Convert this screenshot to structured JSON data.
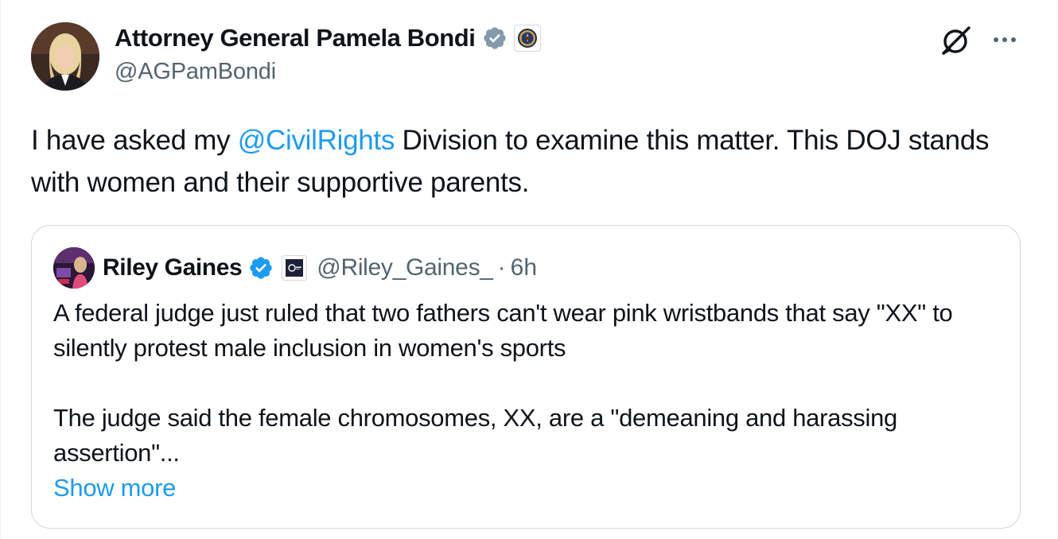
{
  "colors": {
    "accent": "#1d9bf0",
    "text": "#0f1419",
    "secondary": "#536471",
    "verified_gray": "#829aab",
    "verified_blue": "#1d9bf0"
  },
  "author": {
    "display_name": "Attorney General Pamela Bondi",
    "handle": "@AGPamBondi",
    "badge_icon": "verified-gray-badge-icon",
    "affiliation_icon": "doj-seal-icon"
  },
  "actions": {
    "grok_icon": "grok-icon",
    "more_icon": "more-horizontal-icon"
  },
  "tweet": {
    "text_before": "I have asked my ",
    "mention": "@CivilRights",
    "text_after": " Division to examine this matter. This DOJ stands with women and their supportive parents."
  },
  "quote": {
    "display_name": "Riley Gaines",
    "handle": "@Riley_Gaines_",
    "separator": "·",
    "time": "6h",
    "badge_icon": "verified-blue-badge-icon",
    "affiliation_icon": "affiliate-logo-icon",
    "paragraph_1": "A federal judge just ruled that two fathers can't wear pink wristbands that say \"XX\" to silently protest male inclusion in women's sports",
    "paragraph_2": "The judge said the female chromosomes, XX, are a \"demeaning and harassing assertion\"...",
    "show_more": "Show more"
  }
}
